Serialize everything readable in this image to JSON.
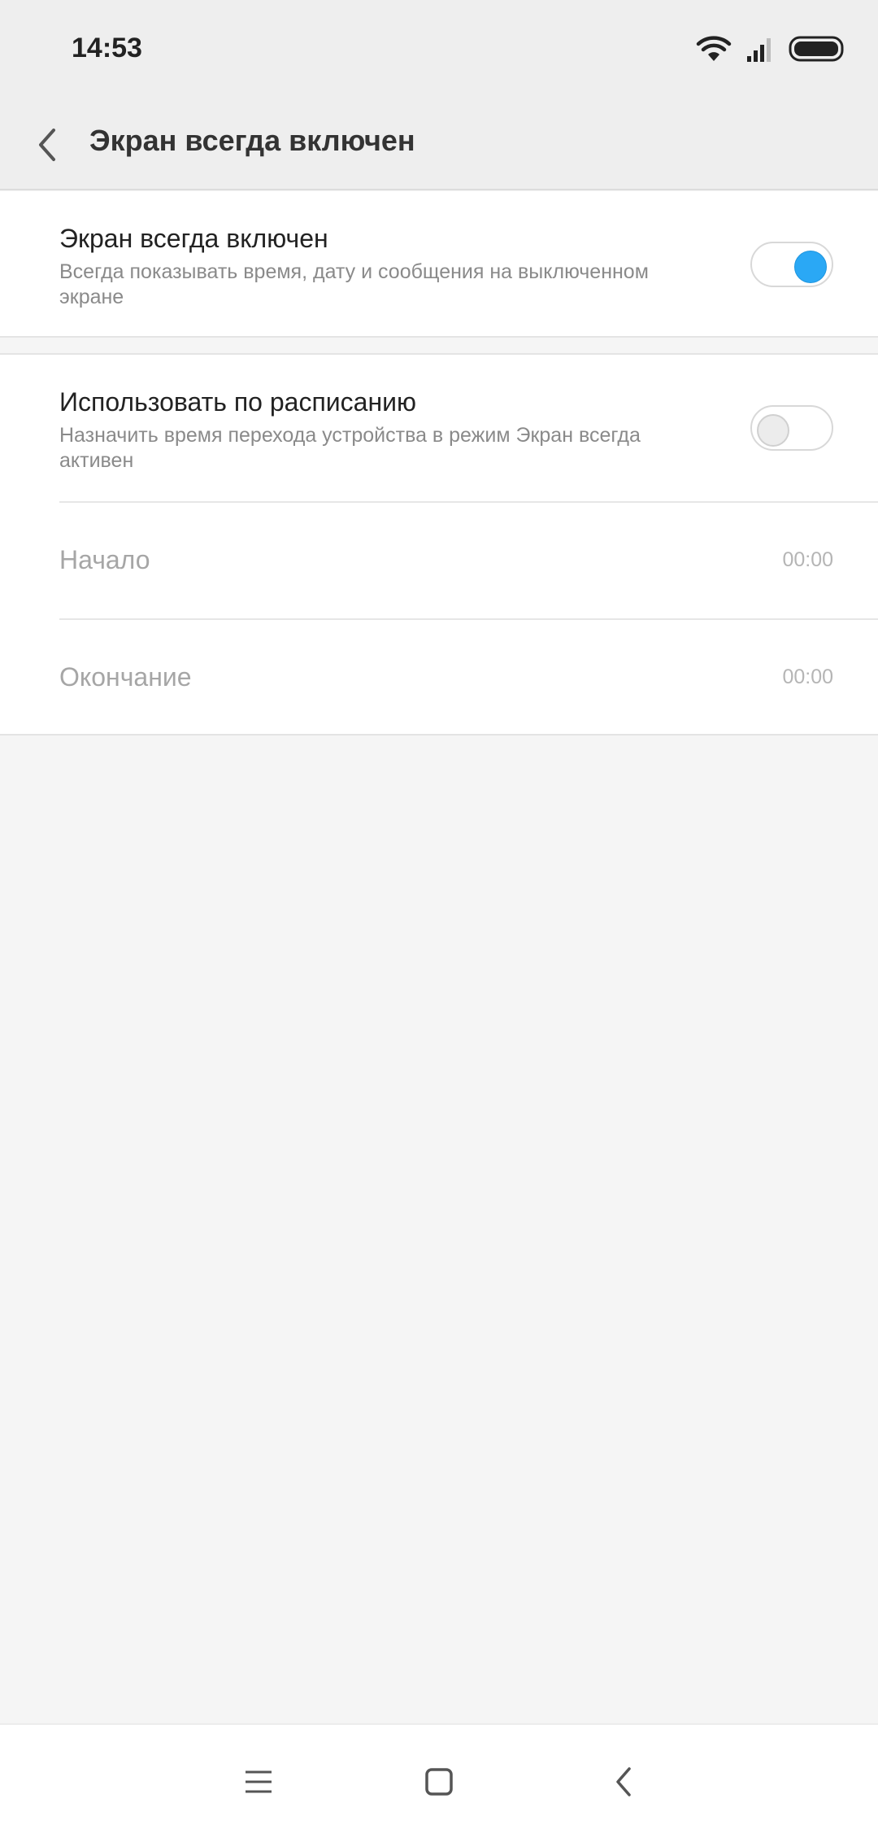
{
  "status_bar": {
    "time": "14:53",
    "icons": [
      "wifi-icon",
      "signal-icon",
      "battery-icon"
    ]
  },
  "header": {
    "back_icon": "chevron-left-icon",
    "title": "Экран всегда включен"
  },
  "settings": {
    "always_on": {
      "title": "Экран всегда включен",
      "subtitle_line1": "Всегда показывать время, дату и сообщения на выключенном",
      "subtitle_line2": "экране",
      "enabled": true
    },
    "schedule": {
      "title": "Использовать по расписанию",
      "subtitle_line1": "Назначить время перехода устройства в режим Экран всегда",
      "subtitle_line2": "активен",
      "enabled": false
    },
    "start": {
      "label": "Начало",
      "value": "00:00"
    },
    "end": {
      "label": "Окончание",
      "value": "00:00"
    }
  },
  "nav_bar": {
    "icons": [
      "menu-icon",
      "home-icon",
      "back-icon"
    ]
  },
  "colors": {
    "accent": "#2aa8f5",
    "background": "#f5f5f5",
    "header_bg": "#eeeeee"
  }
}
